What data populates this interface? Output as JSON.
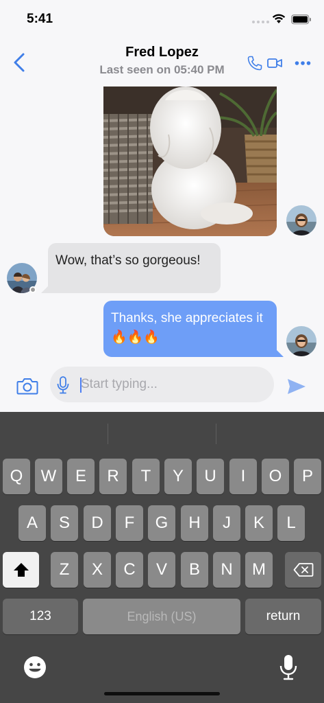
{
  "status_bar": {
    "time": "5:41"
  },
  "header": {
    "contact_name": "Fred Lopez",
    "last_seen": "Last seen on 05:40 PM"
  },
  "messages": [
    {
      "direction": "outgoing",
      "type": "image",
      "image_subject": "white fluffy cat next to wicker basket"
    },
    {
      "direction": "incoming",
      "type": "text",
      "text": "Wow, that’s so gorgeous!"
    },
    {
      "direction": "outgoing",
      "type": "text",
      "text": "Thanks, she appreciates it 🔥🔥🔥"
    }
  ],
  "composer": {
    "placeholder": "Start typing...",
    "value": ""
  },
  "keyboard": {
    "row1": [
      "Q",
      "W",
      "E",
      "R",
      "T",
      "Y",
      "U",
      "I",
      "O",
      "P"
    ],
    "row2": [
      "A",
      "S",
      "D",
      "F",
      "G",
      "H",
      "J",
      "K",
      "L"
    ],
    "row3": [
      "Z",
      "X",
      "C",
      "V",
      "B",
      "N",
      "M"
    ],
    "numbers_label": "123",
    "space_label": "English (US)",
    "return_label": "return"
  },
  "colors": {
    "accent": "#4c7ef3",
    "outgoing_bubble": "#6e9ef7",
    "incoming_bubble": "#e4e4e6",
    "keyboard_bg": "#464646"
  },
  "icons": [
    "back-chevron",
    "phone",
    "video-camera",
    "more-dots",
    "camera",
    "microphone",
    "send",
    "shift",
    "backspace",
    "emoji",
    "dictation-microphone"
  ]
}
